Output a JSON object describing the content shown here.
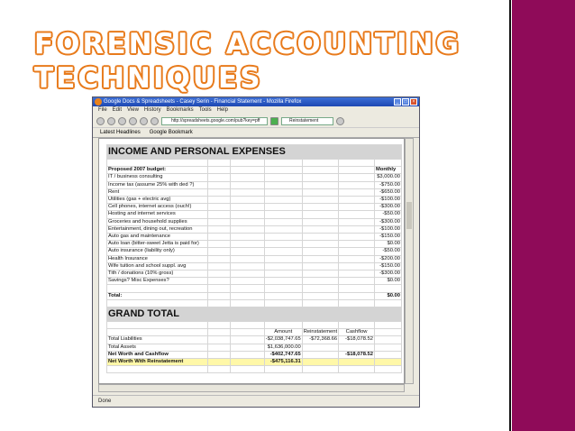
{
  "slide": {
    "title_line1": "FORENSIC ACCOUNTING",
    "title_line2": "TECHNIQUES",
    "accent_color": "#8f0b59",
    "title_outline_color": "#e87b1c"
  },
  "browser": {
    "window_title": "Google Docs & Spreadsheets - Casey Serin - Financial Statement - Mozilla Firefox",
    "menu": [
      "File",
      "Edit",
      "View",
      "History",
      "Bookmarks",
      "Tools",
      "Help"
    ],
    "url": "http://spreadsheets.google.com/pub?key=pff",
    "search_value": "Reinstatement",
    "bookmarks": [
      "Latest Headlines",
      "Google Bookmark"
    ],
    "status": "Done"
  },
  "sheet": {
    "section1_title": "INCOME AND PERSONAL EXPENSES",
    "budget_label": "Proposed 2007 budget:",
    "monthly_label": "Monthly",
    "expenses": [
      {
        "label": "IT / business consulting",
        "value": "$3,000.00"
      },
      {
        "label": "Income tax (assume 25% with ded ?)",
        "value": "-$750.00"
      },
      {
        "label": "Rent",
        "value": "-$650.00"
      },
      {
        "label": "Utilities (gas + electric avg)",
        "value": "-$100.00"
      },
      {
        "label": "Cell phones, internet access (ouch!)",
        "value": "-$300.00"
      },
      {
        "label": "Hosting and internet services",
        "value": "-$50.00"
      },
      {
        "label": "Groceries and household supplies",
        "value": "-$300.00"
      },
      {
        "label": "Entertainment, dining out, recreation",
        "value": "-$100.00"
      },
      {
        "label": "Auto gas and maintenance",
        "value": "-$150.00"
      },
      {
        "label": "Auto loan (bitter-sweet Jetta is paid for)",
        "value": "$0.00"
      },
      {
        "label": "Auto insurance (liability only)",
        "value": "-$50.00"
      },
      {
        "label": "Health Insurance",
        "value": "-$200.00"
      },
      {
        "label": "Wife tuition and school suppl. avg",
        "value": "-$150.00"
      },
      {
        "label": "Tith / donations (10% gross)",
        "value": "-$300.00"
      },
      {
        "label": "Savings? Misc Expenses?",
        "value": "$0.00"
      }
    ],
    "total_label": "Total:",
    "total_value": "$0.00",
    "section2_title": "GRAND TOTAL",
    "grand_headers": [
      "Amount",
      "Reinstatement",
      "Cashflow"
    ],
    "grand_rows": [
      {
        "label": "Total Liabilities",
        "amount": "-$2,038,747.65",
        "reinstatement": "-$72,368.66",
        "cashflow": "-$18,078.52",
        "bold": false,
        "highlight": false
      },
      {
        "label": "Total Assets",
        "amount": "$1,636,000.00",
        "reinstatement": "",
        "cashflow": "",
        "bold": false,
        "highlight": false
      },
      {
        "label": "Net Worth and Cashflow",
        "amount": "-$402,747.65",
        "reinstatement": "",
        "cashflow": "-$18,078.52",
        "bold": true,
        "highlight": false
      },
      {
        "label": "Net Worth With Reinstatement",
        "amount": "-$475,116.31",
        "reinstatement": "",
        "cashflow": "",
        "bold": true,
        "highlight": true
      }
    ]
  }
}
